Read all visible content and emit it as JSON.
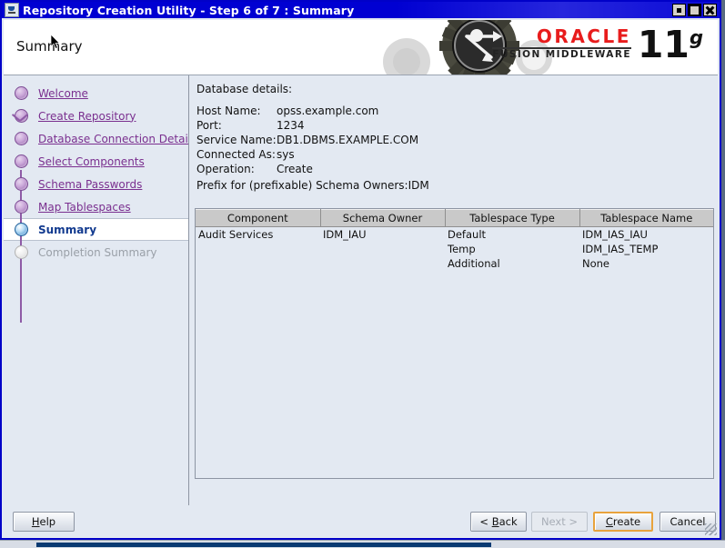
{
  "window": {
    "title": "Repository Creation Utility - Step 6 of 7 : Summary",
    "app_icon": "java-coffee-cup-icon",
    "controls": {
      "minimize": "minimize-icon",
      "maximize": "maximize-icon",
      "close": "close-icon"
    }
  },
  "banner": {
    "page_title": "Summary",
    "gears_graphic": "gears-arrows-graphic",
    "logo": {
      "brand": "ORACLE",
      "trademark": "®",
      "product_line": "FUSION MIDDLEWARE",
      "version": "11",
      "version_suffix": "g"
    },
    "brand_color": "#e81c1c"
  },
  "sidebar": {
    "items": [
      {
        "label": "Welcome",
        "state": "done"
      },
      {
        "label": "Create Repository",
        "state": "done"
      },
      {
        "label": "Database Connection Details",
        "state": "done"
      },
      {
        "label": "Select Components",
        "state": "done"
      },
      {
        "label": "Schema Passwords",
        "state": "done"
      },
      {
        "label": "Map Tablespaces",
        "state": "done"
      },
      {
        "label": "Summary",
        "state": "current"
      },
      {
        "label": "Completion Summary",
        "state": "disabled"
      }
    ]
  },
  "content": {
    "database_details_heading": "Database details:",
    "fields": [
      {
        "key": "Host Name:",
        "value": "opss.example.com"
      },
      {
        "key": "Port:",
        "value": "1234"
      },
      {
        "key": "Service Name:",
        "value": "DB1.DBMS.EXAMPLE.COM"
      },
      {
        "key": "Connected As:",
        "value": "sys"
      },
      {
        "key": "Operation:",
        "value": "Create"
      }
    ],
    "prefix_line": "Prefix for (prefixable) Schema Owners:IDM",
    "table": {
      "columns": [
        "Component",
        "Schema Owner",
        "Tablespace Type",
        "Tablespace Name"
      ],
      "rows": [
        [
          "Audit Services",
          "IDM_IAU",
          "Default",
          "IDM_IAS_IAU"
        ],
        [
          "",
          "",
          "Temp",
          "IDM_IAS_TEMP"
        ],
        [
          "",
          "",
          "Additional",
          "None"
        ]
      ]
    }
  },
  "buttons": {
    "help": {
      "label": "Help",
      "mnemonic": "H",
      "enabled": true
    },
    "back": {
      "label": "< Back",
      "mnemonic": "B",
      "enabled": true
    },
    "next": {
      "label": "Next >",
      "enabled": false
    },
    "create": {
      "label": "Create",
      "mnemonic": "C",
      "enabled": true,
      "focused": true,
      "focus_color": "#e8a33d"
    },
    "cancel": {
      "label": "Cancel",
      "enabled": true
    }
  }
}
